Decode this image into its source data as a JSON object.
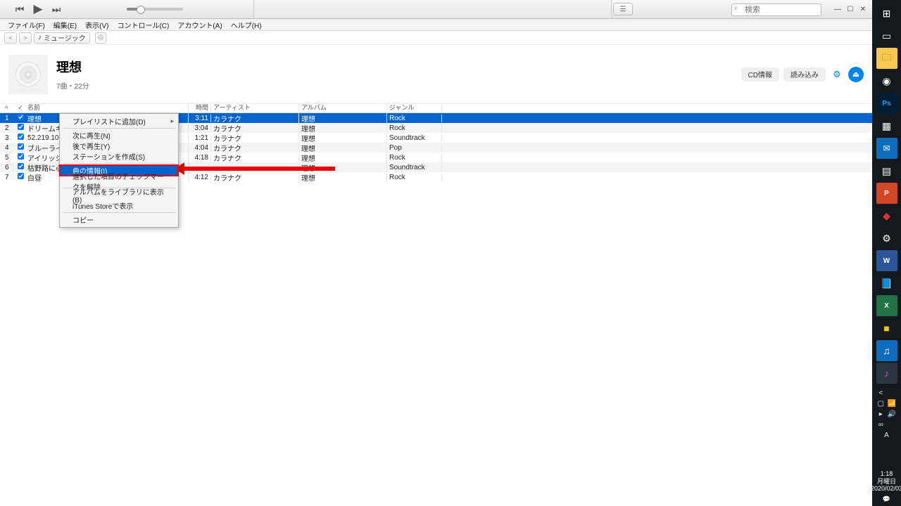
{
  "search": {
    "placeholder": "検索"
  },
  "menus": {
    "file": "ファイル(F)",
    "edit": "編集(E)",
    "view": "表示(V)",
    "control": "コントロール(C)",
    "account": "アカウント(A)",
    "help": "ヘルプ(H)"
  },
  "category_label": "ミュージック",
  "album": {
    "title": "理想",
    "meta": "7曲・22分"
  },
  "header_buttons": {
    "cd_info": "CD情報",
    "import": "読み込み"
  },
  "columns": {
    "num_sort": "^",
    "chk": "✓",
    "name": "名前",
    "time": "時間",
    "artist": "アーティスト",
    "album": "アルバム",
    "genre": "ジャンル"
  },
  "tracks": [
    {
      "n": "1",
      "name": "理想",
      "time": "3:11",
      "artist": "カラナク",
      "album": "理想",
      "genre": "Rock"
    },
    {
      "n": "2",
      "name": "ドリームキラー",
      "time": "3:04",
      "artist": "カラナク",
      "album": "理想",
      "genre": "Rock"
    },
    {
      "n": "3",
      "name": "52.219.1024",
      "time": "1:21",
      "artist": "カラナク",
      "album": "理想",
      "genre": "Soundtrack"
    },
    {
      "n": "4",
      "name": "ブルーライン",
      "time": "4:04",
      "artist": "カラナク",
      "album": "理想",
      "genre": "Pop"
    },
    {
      "n": "5",
      "name": "アイリッシュナ",
      "time": "4:18",
      "artist": "カラナク",
      "album": "理想",
      "genre": "Rock"
    },
    {
      "n": "6",
      "name": "枯野路に心",
      "time": "",
      "artist": "",
      "album": "理想",
      "genre": "Soundtrack"
    },
    {
      "n": "7",
      "name": "白昼",
      "time": "4:12",
      "artist": "カラナク",
      "album": "理想",
      "genre": "Rock"
    }
  ],
  "context_menu": {
    "add_playlist": "プレイリストに追加(D)",
    "play_next": "次に再生(N)",
    "play_later": "後で再生(Y)",
    "create_station": "ステーションを作成(S)",
    "song_info": "曲の情報(I)",
    "uncheck": "選択した項目のチェックマークを解除",
    "show_in_library": "アルバムをライブラリに表示(B)",
    "show_in_store": "iTunes Storeで表示",
    "copy": "コピー"
  },
  "clock": {
    "time": "1:18",
    "day": "月曜日",
    "date": "2020/02/03"
  }
}
